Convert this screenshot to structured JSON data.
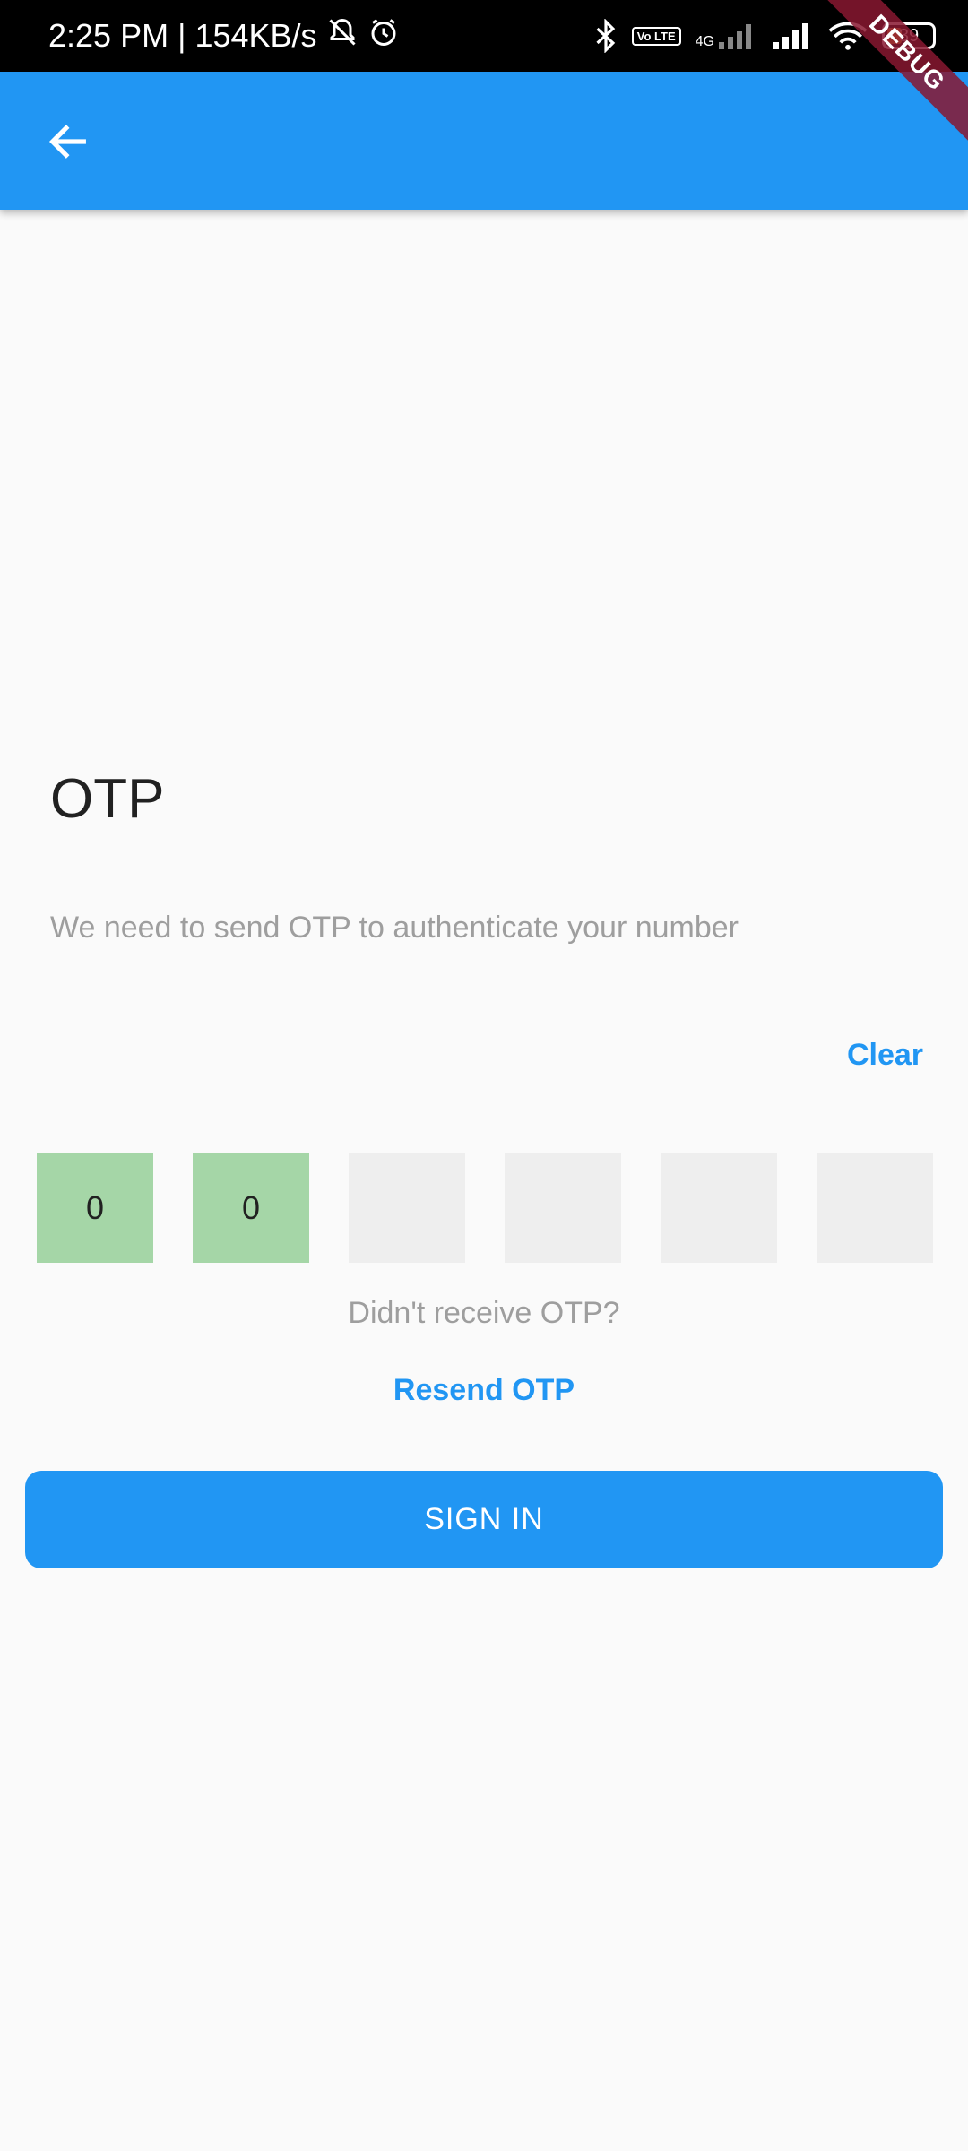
{
  "status_bar": {
    "time": "2:25 PM",
    "separator": "|",
    "speed": "154KB/s",
    "lte_label": "Vo LTE",
    "network": "4G",
    "battery": "39",
    "icons": [
      "mute-icon",
      "alarm-icon",
      "bluetooth-icon",
      "volte-icon",
      "signal-icon",
      "wifi-icon",
      "battery-icon"
    ]
  },
  "debug_banner": "DEBUG",
  "app_bar": {
    "color": "#2196f3",
    "back_icon": "arrow-back-icon"
  },
  "content": {
    "title": "OTP",
    "subtitle": "We need to send OTP to authenticate your number",
    "clear_label": "Clear",
    "otp_digits": [
      "0",
      "0",
      "",
      "",
      "",
      ""
    ],
    "didnt_receive": "Didn't receive OTP?",
    "resend_label": "Resend OTP",
    "sign_in_label": "SIGN IN"
  },
  "colors": {
    "accent": "#2196f3",
    "filled_box": "#a5d6a7",
    "empty_box": "#eeeeee",
    "background": "#fafafa"
  }
}
